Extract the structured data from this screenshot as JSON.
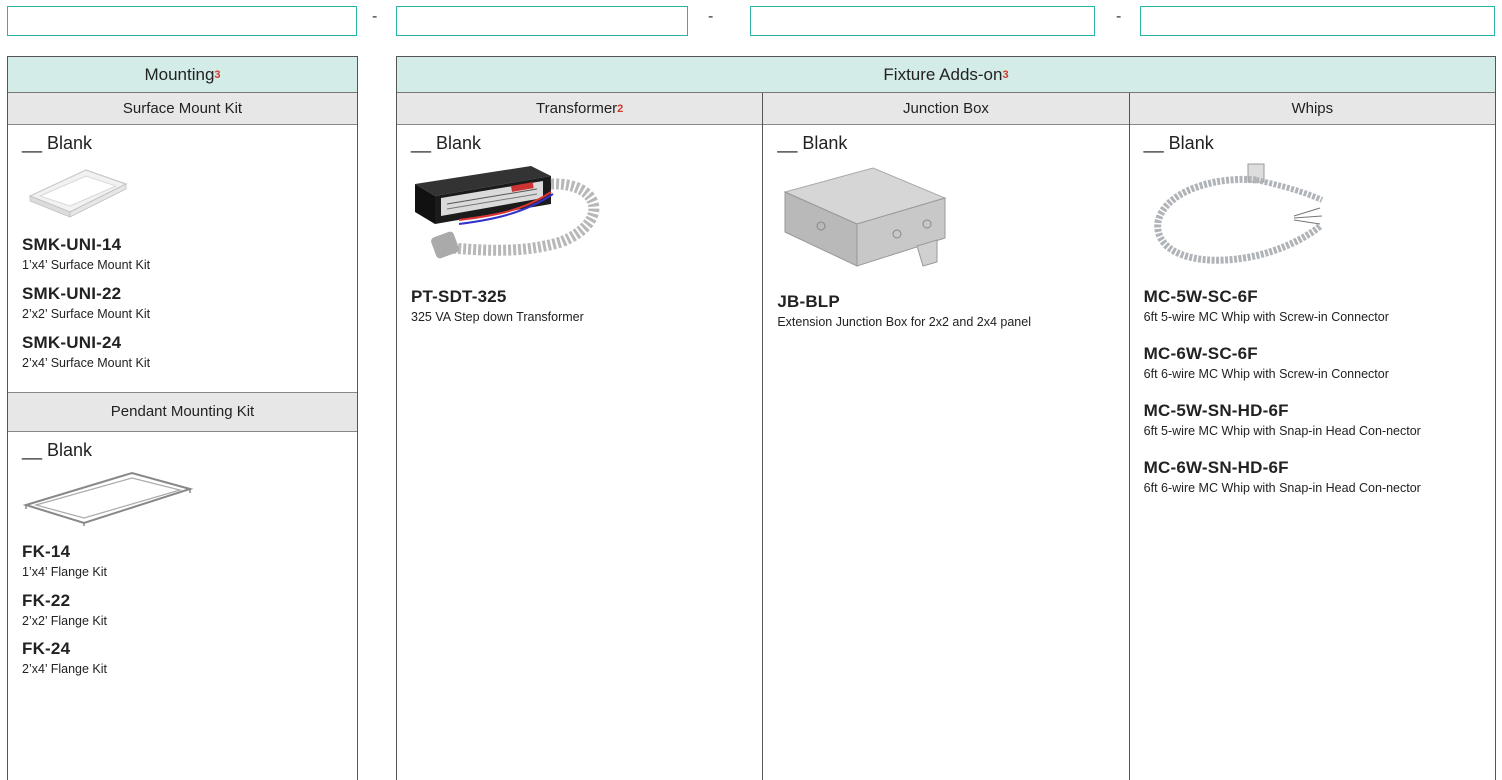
{
  "header": {
    "separators": [
      "-",
      "-",
      "-"
    ],
    "code_boxes": [
      "",
      "",
      "",
      ""
    ]
  },
  "mounting": {
    "title": "Mounting",
    "note": "3",
    "surface_title": "Surface Mount Kit",
    "surface_blank": "__ Blank",
    "surface_options": [
      {
        "code": "SMK-UNI-14",
        "desc": "1’x4’ Surface Mount Kit"
      },
      {
        "code": "SMK-UNI-22",
        "desc": "2’x2’ Surface Mount Kit"
      },
      {
        "code": "SMK-UNI-24",
        "desc": "2’x4’ Surface Mount Kit"
      }
    ],
    "pendant_title": "Pendant Mounting Kit",
    "pendant_blank": "__ Blank",
    "pendant_options": [
      {
        "code": "FK-14",
        "desc": "1’x4’ Flange Kit"
      },
      {
        "code": "FK-22",
        "desc": "2’x2’ Flange Kit"
      },
      {
        "code": "FK-24",
        "desc": "2’x4’ Flange Kit"
      }
    ]
  },
  "addons": {
    "title": "Fixture Adds-on",
    "note": "3",
    "transformer": {
      "title": "Transformer",
      "note": "2",
      "blank": "__ Blank",
      "options": [
        {
          "code": "PT-SDT-325",
          "desc": "325 VA Step down Transformer"
        }
      ]
    },
    "junction": {
      "title": "Junction Box",
      "blank": "__ Blank",
      "options": [
        {
          "code": "JB-BLP",
          "desc": "Extension Junction Box for 2x2 and 2x4 panel"
        }
      ]
    },
    "whips": {
      "title": "Whips",
      "blank": "__ Blank",
      "options": [
        {
          "code": "MC-5W-SC-6F",
          "desc": "6ft 5-wire MC Whip with Screw-in Connector"
        },
        {
          "code": "MC-6W-SC-6F",
          "desc": "6ft 6-wire MC Whip with Screw-in Connector"
        },
        {
          "code": "MC-5W-SN-HD-6F",
          "desc": "6ft 5-wire MC Whip with Snap-in Head Con-nector"
        },
        {
          "code": "MC-6W-SN-HD-6F",
          "desc": "6ft 6-wire MC Whip with Snap-in Head Con-nector"
        }
      ]
    }
  }
}
